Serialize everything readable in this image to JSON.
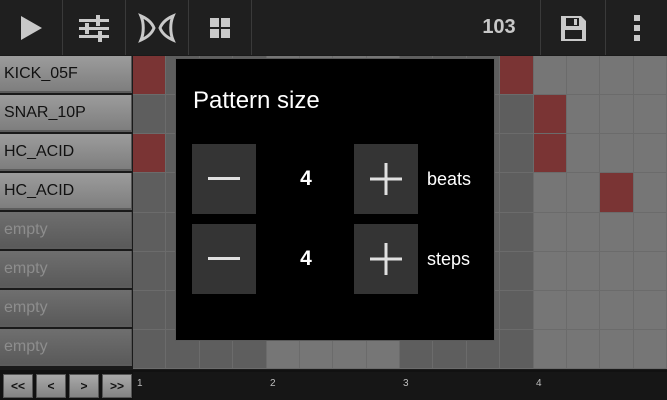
{
  "toolbar": {
    "play_icon": "play-icon",
    "mixer_icon": "sliders-icon",
    "effects_icon": "bowtie-icon",
    "patterns_icon": "grid-icon",
    "tempo": "103",
    "save_icon": "save-icon",
    "menu_icon": "overflow-menu-icon"
  },
  "tracks": [
    {
      "label": "KICK_05F"
    },
    {
      "label": "SNAR_10P"
    },
    {
      "label": "HC_ACID"
    },
    {
      "label": "HC_ACID"
    },
    {
      "label": "empty"
    },
    {
      "label": "empty"
    },
    {
      "label": "empty"
    },
    {
      "label": "empty"
    }
  ],
  "grid": {
    "active_steps": [
      [
        0,
        0
      ],
      [
        0,
        11
      ],
      [
        1,
        12
      ],
      [
        2,
        0
      ],
      [
        2,
        12
      ],
      [
        3,
        14
      ]
    ]
  },
  "nav": {
    "first": "<<",
    "prev": "<",
    "next": ">",
    "last": ">>"
  },
  "ruler": [
    "1",
    "2",
    "3",
    "4"
  ],
  "dialog": {
    "title": "Pattern size",
    "rows": [
      {
        "value": "4",
        "label": "beats"
      },
      {
        "value": "4",
        "label": "steps"
      }
    ]
  },
  "colors": {
    "accent_active": "#7a3434",
    "cell_light": "#767676",
    "cell_dark": "#5e5e5e"
  }
}
